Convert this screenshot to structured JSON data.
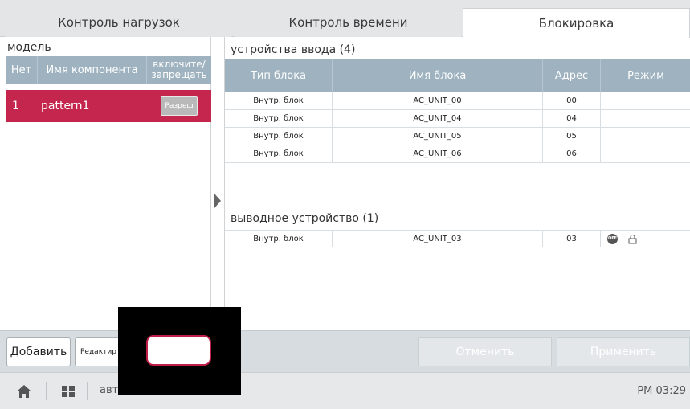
{
  "tabs": [
    {
      "label": "Контроль нагрузок",
      "active": false
    },
    {
      "label": "Контроль времени",
      "active": false
    },
    {
      "label": "Блокировка",
      "active": true
    }
  ],
  "left": {
    "title": "модель",
    "headers": {
      "no": "Нет",
      "name": "Имя компонента",
      "enable": "включите/ запрещать"
    },
    "rows": [
      {
        "no": "1",
        "name": "pattern1",
        "action": "Разреш",
        "selected": true
      }
    ]
  },
  "input_devices": {
    "title": "устройства ввода (4)",
    "headers": {
      "type": "Тип блока",
      "name": "Имя блока",
      "address": "Адрес",
      "mode": "Режим"
    },
    "rows": [
      {
        "type": "Внутр. блок",
        "name": "AC_UNIT_00",
        "address": "00",
        "mode": ""
      },
      {
        "type": "Внутр. блок",
        "name": "AC_UNIT_04",
        "address": "04",
        "mode": ""
      },
      {
        "type": "Внутр. блок",
        "name": "AC_UNIT_05",
        "address": "05",
        "mode": ""
      },
      {
        "type": "Внутр. блок",
        "name": "AC_UNIT_06",
        "address": "06",
        "mode": ""
      }
    ]
  },
  "output_devices": {
    "title": "выводное устройство (1)",
    "rows": [
      {
        "type": "Внутр. блок",
        "name": "AC_UNIT_03",
        "address": "03",
        "mode_off": "OFF",
        "mode_icon": "lock-icon"
      }
    ]
  },
  "actions": {
    "add": "Добавить",
    "edit": "Редактир",
    "cancel": "Отменить",
    "apply": "Применить"
  },
  "status": {
    "label": "автоматизации",
    "time": "PM 03:29"
  },
  "colors": {
    "accent": "#c5264d",
    "header": "#9eb2bf"
  }
}
